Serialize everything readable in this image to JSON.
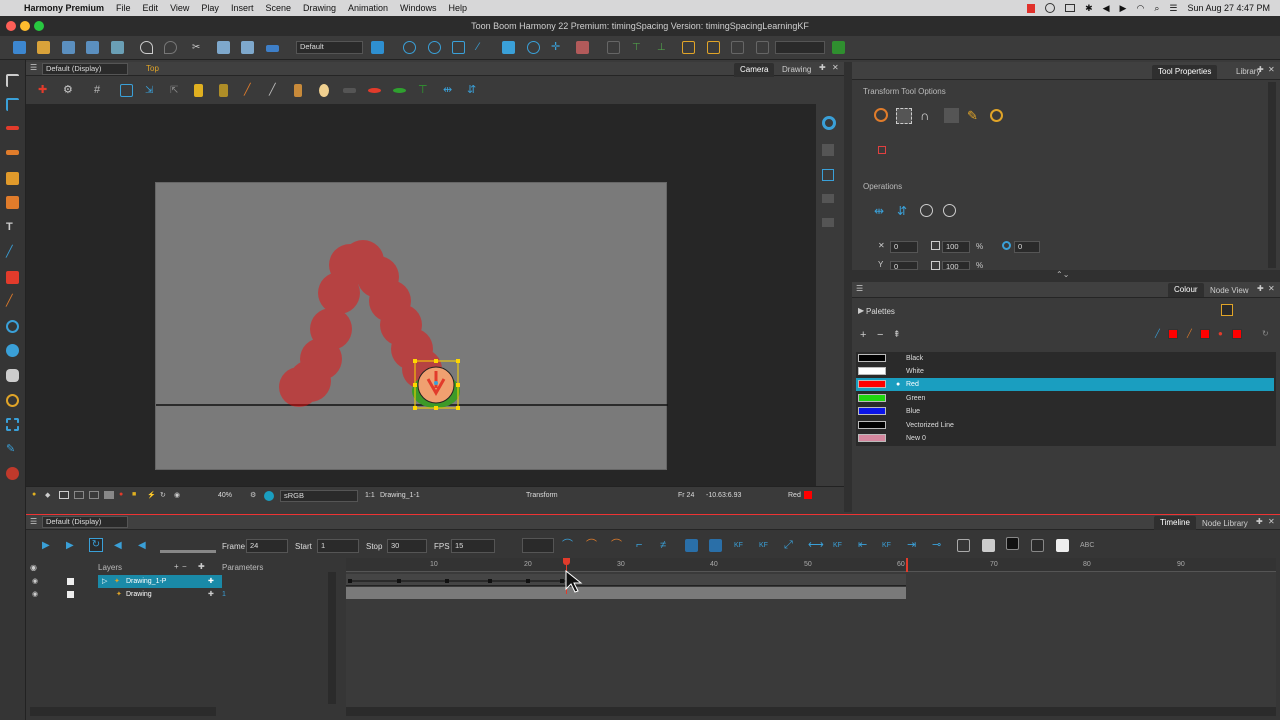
{
  "menubar": {
    "app": "Harmony Premium",
    "items": [
      "File",
      "Edit",
      "View",
      "Play",
      "Insert",
      "Scene",
      "Drawing",
      "Animation",
      "Windows",
      "Help"
    ],
    "datetime": "Sun Aug 27  4:47 PM"
  },
  "window": {
    "title": "Toon Boom Harmony 22 Premium: timingSpacing Version: timingSpacingLearningKF"
  },
  "toolbar": {
    "workspace": "Default"
  },
  "camera_panel": {
    "display": "Default (Display)",
    "view": "Top",
    "tabs": [
      "Camera",
      "Drawing"
    ],
    "active_tab": "Camera"
  },
  "statusbar": {
    "zoom": "40%",
    "color_space": "sRGB",
    "ratio": "1:1",
    "drawing": "Drawing_1-1",
    "tool": "Transform",
    "frame": "Fr 24",
    "coords": "-10.63:6.93",
    "colour_name": "Red"
  },
  "tool_properties": {
    "tabs": [
      "Tool Properties",
      "Library"
    ],
    "active_tab": "Tool Properties",
    "section_title": "Transform Tool Options",
    "operations_title": "Operations",
    "x_value": "0",
    "width_value": "100",
    "angle_value": "0",
    "y_value": "0",
    "height_value": "100",
    "percent": "%"
  },
  "colour_panel": {
    "tabs": [
      "Colour",
      "Node View"
    ],
    "active_tab": "Colour",
    "palettes_label": "Palettes",
    "swatches": [
      {
        "name": "Black",
        "color": "#000000"
      },
      {
        "name": "White",
        "color": "#ffffff"
      },
      {
        "name": "Red",
        "color": "#ff0000"
      },
      {
        "name": "Green",
        "color": "#1fd60f"
      },
      {
        "name": "Blue",
        "color": "#0b14e8"
      },
      {
        "name": "Vectorized Line",
        "color": "#000000"
      },
      {
        "name": "New 0",
        "color": "#d4879e"
      }
    ],
    "selected_swatch": "Red"
  },
  "timeline": {
    "display": "Default (Display)",
    "tabs": [
      "Timeline",
      "Node Library"
    ],
    "active_tab": "Timeline",
    "frame_label": "Frame",
    "frame_value": "24",
    "start_label": "Start",
    "start_value": "1",
    "stop_label": "Stop",
    "stop_value": "30",
    "fps_label": "FPS",
    "fps_value": "15",
    "layers_header": "Layers",
    "parameters_header": "Parameters",
    "layers": [
      {
        "name": "Drawing_1-P",
        "selected": true
      },
      {
        "name": "Drawing",
        "selected": false,
        "value": "1"
      }
    ],
    "ruler": [
      "10",
      "20",
      "30",
      "40",
      "50",
      "60",
      "70",
      "80",
      "90"
    ],
    "playhead_frame": 24,
    "scene_end_frame": 60
  },
  "colors": {
    "accent": "#1a9ec0",
    "red": "#ff0000",
    "panel_bg": "#3a3a3a"
  }
}
